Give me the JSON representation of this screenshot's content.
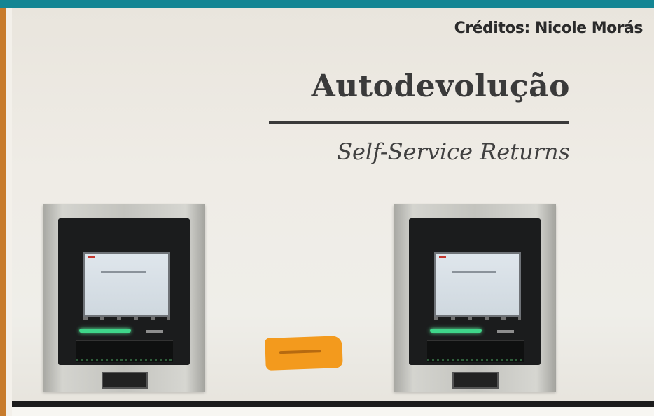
{
  "credits": "Créditos: Nicole Morás",
  "sign": {
    "title": "Autodevolução",
    "subtitle": "Self-Service Returns"
  },
  "kiosks": [
    {
      "id": "left",
      "led_color": "#3fd68a"
    },
    {
      "id": "right",
      "led_color": "#3fd68a"
    }
  ],
  "colors": {
    "frame_top": "#138593",
    "frame_left": "#c77b2c",
    "wall": "#efece6",
    "sticker": "#f39a1d"
  }
}
